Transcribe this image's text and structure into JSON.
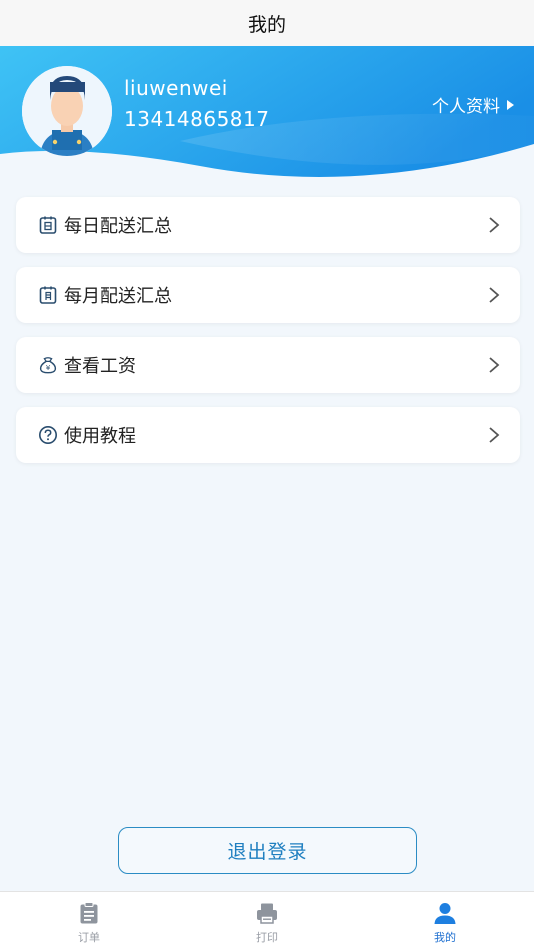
{
  "page_title": "我的",
  "profile": {
    "username": "liuwenwei",
    "phone": "13414865817",
    "link_label": "个人资料"
  },
  "menu": [
    {
      "label": "每日配送汇总",
      "icon": "daily-calendar-icon"
    },
    {
      "label": "每月配送汇总",
      "icon": "monthly-calendar-icon"
    },
    {
      "label": "查看工资",
      "icon": "money-bag-icon"
    },
    {
      "label": "使用教程",
      "icon": "help-circle-icon"
    }
  ],
  "logout_label": "退出登录",
  "tabs": [
    {
      "label": "订单",
      "icon": "clipboard-icon",
      "active": false
    },
    {
      "label": "打印",
      "icon": "printer-icon",
      "active": false
    },
    {
      "label": "我的",
      "icon": "user-icon",
      "active": true
    }
  ],
  "colors": {
    "accent": "#1e6fd0",
    "header_gradient_start": "#3fc3f5",
    "header_gradient_end": "#1a8fe6",
    "logout_border": "#2b8cc4"
  }
}
